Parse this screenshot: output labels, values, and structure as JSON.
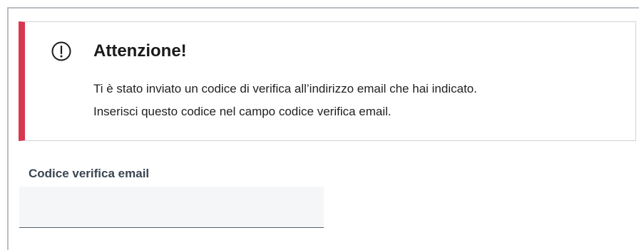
{
  "alert": {
    "icon": "alert-circle-icon",
    "title": "Attenzione!",
    "lines": [
      "Ti è stato inviato un codice di verifica all’indirizzo email che hai indicato.",
      "Inserisci questo codice nel campo codice verifica email."
    ],
    "accent_color": "#d9364f"
  },
  "form": {
    "verification_code": {
      "label": "Codice verifica email",
      "value": "",
      "placeholder": ""
    }
  }
}
